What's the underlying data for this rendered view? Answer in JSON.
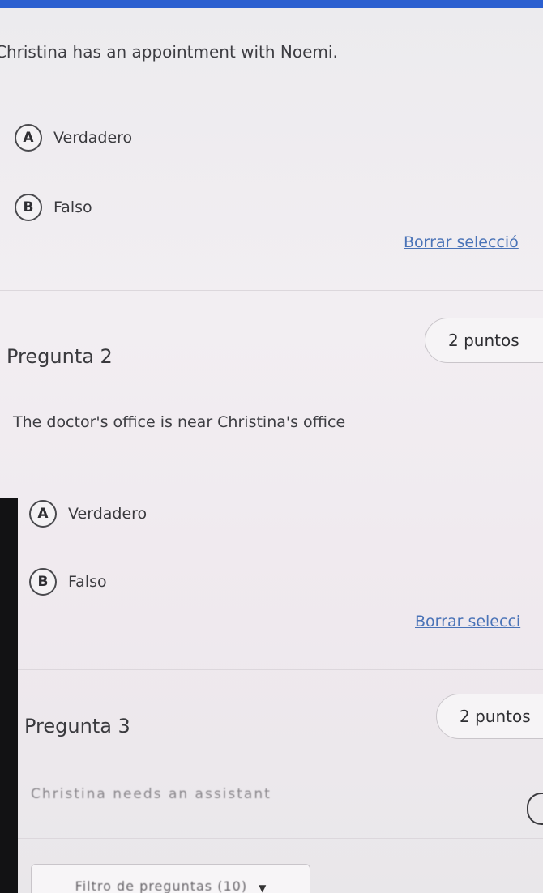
{
  "question1": {
    "text": "Christina has an appointment with Noemi.",
    "options": [
      {
        "letter": "A",
        "label": "Verdadero"
      },
      {
        "letter": "B",
        "label": "Falso"
      }
    ],
    "clear_label": "Borrar selecció"
  },
  "question2": {
    "title": "Pregunta 2",
    "points": "2 puntos",
    "text": "The doctor's office is near Christina's office",
    "options": [
      {
        "letter": "A",
        "label": "Verdadero"
      },
      {
        "letter": "B",
        "label": "Falso"
      }
    ],
    "clear_label": "Borrar selecci"
  },
  "question3": {
    "title": "Pregunta 3",
    "points": "2 puntos",
    "text": "Christina needs an assistant"
  },
  "filter": {
    "label": "Filtro de preguntas (10)"
  },
  "colors": {
    "accent_bar": "#2b5fd0",
    "link": "#4a73b7"
  }
}
